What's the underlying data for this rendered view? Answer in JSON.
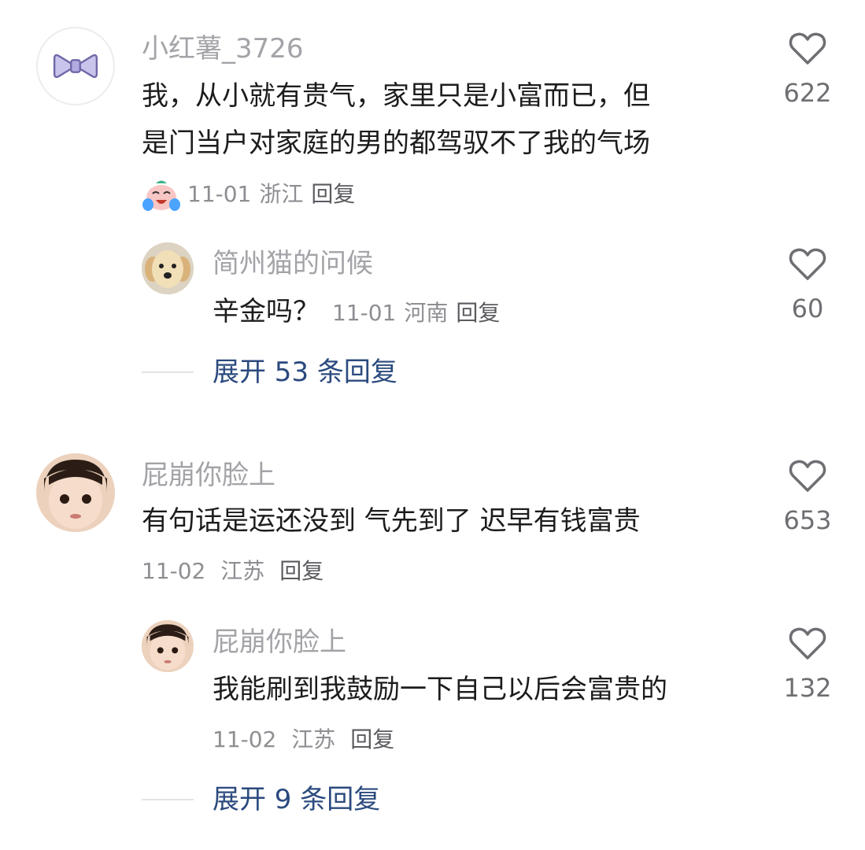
{
  "comments": [
    {
      "username": "小红薯_3726",
      "text_line1": "我，从小就有贵气，家里只是小富而已，但",
      "text_line2": "是门当户对家庭的男的都驾驭不了我的气场",
      "date": "11-01",
      "location": "浙江",
      "reply_label": "回复",
      "likes": "622",
      "avatar_icon": "bow-icon",
      "emoji_icon": "crying-laughing-emoji-icon",
      "reply": {
        "username": "简州猫的问候",
        "text": "辛金吗？",
        "date": "11-01",
        "location": "河南",
        "reply_label": "回复",
        "likes": "60",
        "avatar_icon": "dog-avatar-icon"
      },
      "expand_label": "展开 53 条回复"
    },
    {
      "username": "屁崩你脸上",
      "text": "有句话是运还没到 气先到了 迟早有钱富贵",
      "date": "11-02",
      "location": "江苏",
      "reply_label": "回复",
      "likes": "653",
      "avatar_icon": "child-avatar-icon",
      "reply": {
        "username": "屁崩你脸上",
        "text": "我能刷到我鼓励一下自己以后会富贵的",
        "date": "11-02",
        "location": "江苏",
        "reply_label": "回复",
        "likes": "132",
        "avatar_icon": "child-avatar-icon"
      },
      "expand_label": "展开 9 条回复"
    }
  ],
  "colors": {
    "username": "#a3a3a8",
    "text": "#1c1c1e",
    "meta": "#8e8e93",
    "expand": "#2b4a7e"
  }
}
